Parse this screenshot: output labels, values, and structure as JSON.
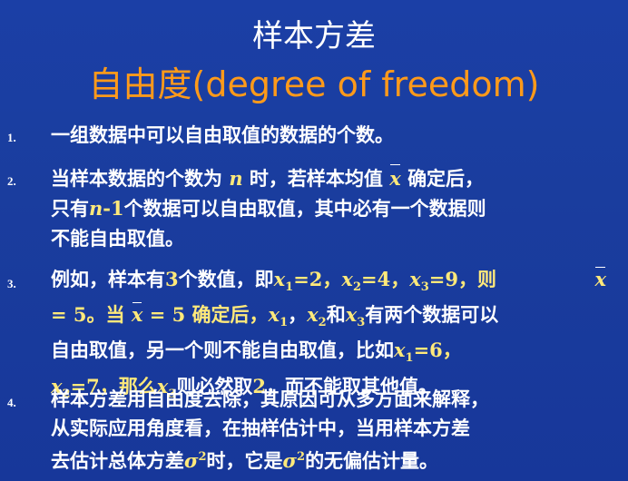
{
  "title": {
    "line1": "样本方差",
    "line2": "自由度(degree of freedom)"
  },
  "items": [
    {
      "num": "1.",
      "text": "一组数据中可以自由取值的数据的个数。"
    },
    {
      "num": "2.",
      "a": "当样本数据的个数为",
      "n": "n",
      "b": "时，若样本均值",
      "xbar": "x",
      "c": "确定后，",
      "d": "只有",
      "n1": "n",
      "e": "-1",
      "f": "个数据可以自由取值，其中必有一个数据则",
      "g": "不能自由取值。"
    },
    {
      "num": "3.",
      "a": "例如，样本有",
      "three": "3",
      "b": "个数值，即",
      "x": "x",
      "s1": "1",
      "eq1": "=2，",
      "s2": "2",
      "eq2": "=4，",
      "s3": "3",
      "eq3": "=9，则",
      "xbar": "x",
      "c": "= 5。当",
      "d": "= 5 确定后，",
      "comma": "，",
      "he": "和",
      "e": "有两个数据可以",
      "f": "自由取值，另一个则不能自由取值，比如",
      "eq4": "=6，",
      "eq5": "=7，那么",
      "g": "则必然取",
      "two": "2",
      "h": "，而不能取其他值。"
    },
    {
      "num": "4.",
      "a": "样本方差用自由度去除，其原因可从多方面来解释，",
      "b": "从实际应用角度看，在抽样估计中，当用样本方差",
      "c": "去估计总体方差",
      "sigma": "σ",
      "sq": "2",
      "d": "时，它是",
      "e": "的无偏估计量。"
    }
  ]
}
